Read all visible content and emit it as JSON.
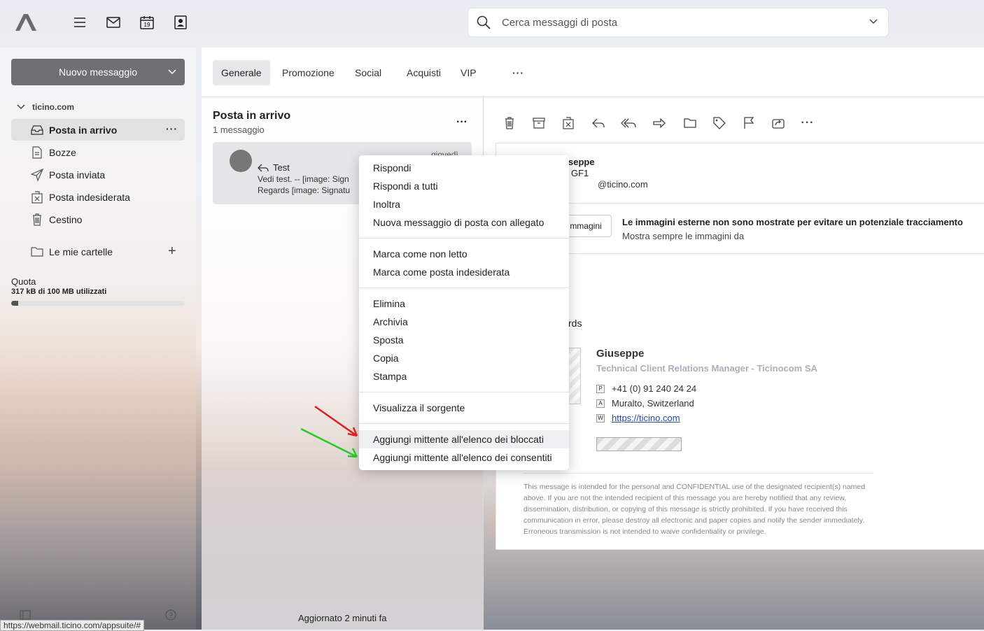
{
  "header": {
    "search_placeholder": "Cerca messaggi di posta",
    "calendar_day": "19"
  },
  "sidebar": {
    "new_message_label": "Nuovo messaggio",
    "account": "ticino.com",
    "folders": [
      {
        "label": "Posta in arrivo"
      },
      {
        "label": "Bozze"
      },
      {
        "label": "Posta inviata"
      },
      {
        "label": "Posta indesiderata"
      },
      {
        "label": "Cestino"
      }
    ],
    "my_folders": "Le mie cartelle",
    "quota_title": "Quota",
    "quota_text": "317 kB di 100 MB utilizzati",
    "quota_fraction": 0.04,
    "status_url": "https://webmail.ticino.com/appsuite/#"
  },
  "tabs": [
    "Generale",
    "Promozione",
    "Social",
    "Acquisti",
    "VIP"
  ],
  "list": {
    "title": "Posta in arrivo",
    "count": "1 messaggio",
    "item": {
      "subject": "Test",
      "preview1": "Vedi test. -- [image: Sign",
      "preview2": "Regards [image: Signatu",
      "date": "giovedì"
    },
    "updated": "Aggiornato 2 minuti fa"
  },
  "detail": {
    "from_name": "seppe",
    "from_sub": "GF1",
    "from_email": "@ticino.com",
    "images_button": "mmagini",
    "images_warning": "Le immagini esterne non sono mostrate per evitare un potenziale tracciamento",
    "images_always": "Mostra sempre le immagini da",
    "regards": "rds",
    "signature": {
      "name": "Giuseppe",
      "role": "Technical Client Relations Manager - Ticinocom SA",
      "phone_key": "P",
      "phone": "+41 (0) 91 240 24 24",
      "address_key": "A",
      "address": "Muralto, Switzerland",
      "web_key": "W",
      "web": "https://ticino.com"
    },
    "disclaimer": "This message is intended for the personal and CONFIDENTIAL use of the designated recipient(s) named above. If you are not the intended recipient of this message you are hereby notified that any review, dissemination, distribution, or copying of this message is strictly prohibited. If you have received this communication in error, please destroy all electronic and paper copies and notify the sender immediately. Erroneous transmission is not intended to waive confidentiality or privilege."
  },
  "context_menu": {
    "items": [
      "Rispondi",
      "Rispondi a tutti",
      "Inoltra",
      "Nuova messaggio di posta con allegato",
      "Marca come non letto",
      "Marca come posta indesiderata",
      "Elimina",
      "Archivia",
      "Sposta",
      "Copia",
      "Stampa",
      "Visualizza il sorgente",
      "Aggiungi mittente all'elenco dei bloccati",
      "Aggiungi mittente all'elenco dei consentiti"
    ]
  },
  "colors": {
    "arrow_red": "#e02020",
    "arrow_green": "#22cc22"
  }
}
